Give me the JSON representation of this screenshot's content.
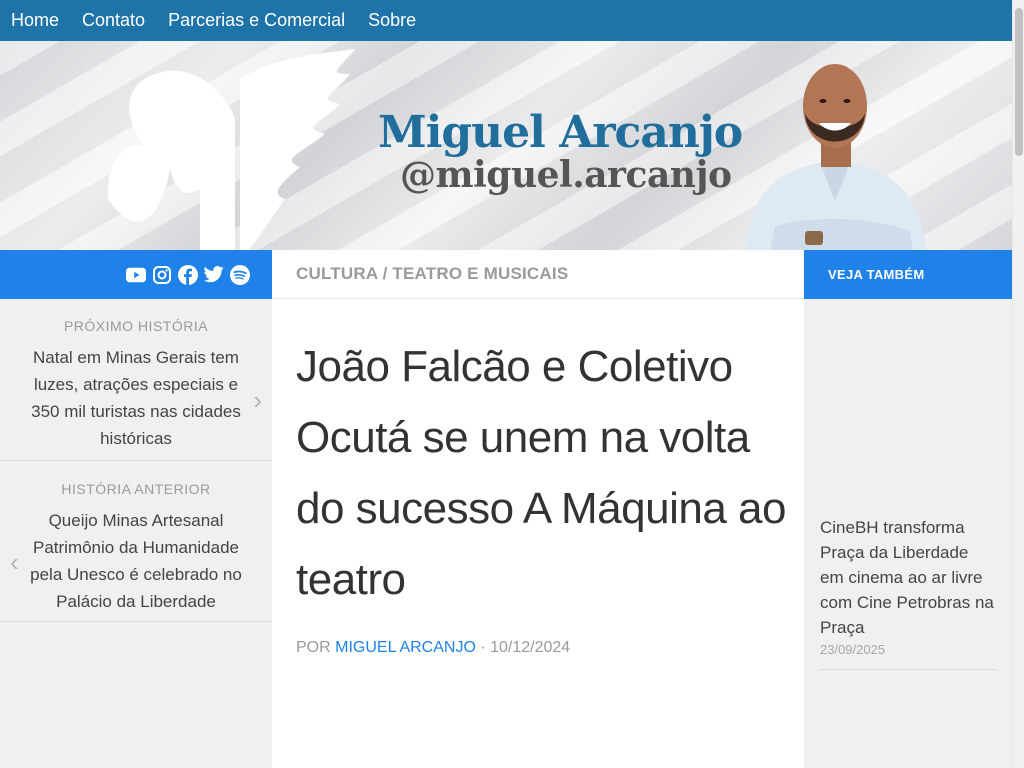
{
  "nav": [
    "Home",
    "Contato",
    "Parcerias e Comercial",
    "Sobre"
  ],
  "banner": {
    "name": "Miguel Arcanjo",
    "handle": "@miguel.arcanjo"
  },
  "social_icons": [
    "youtube-icon",
    "instagram-icon",
    "facebook-icon",
    "twitter-icon",
    "spotify-icon"
  ],
  "colors": {
    "nav_bg": "#1e73a8",
    "accent": "#1e82e8"
  },
  "post_nav": {
    "next_kicker": "PRÓXIMO HISTÓRIA",
    "next_title": "Natal em Minas Gerais tem luzes, atrações especiais e 350 mil turistas nas cidades históricas",
    "prev_kicker": "HISTÓRIA ANTERIOR",
    "prev_title": "Queijo Minas Artesanal Patrimônio da Humanidade pela Unesco é celebrado no Palácio da Liberdade"
  },
  "article": {
    "category": "CULTURA / TEATRO E MUSICAIS",
    "title": "João Falcão e Coletivo Ocutá se unem na volta do sucesso A Máquina ao teatro",
    "by_prefix": "POR",
    "author": "MIGUEL ARCANJO",
    "separator": "·",
    "date": "10/12/2024"
  },
  "sidebar": {
    "heading": "VEJA TAMBÉM",
    "related": [
      {
        "title": "CineBH transforma Praça da Liberdade em cinema ao ar livre com Cine Petrobras na Praça",
        "date": "23/09/2025"
      }
    ]
  }
}
